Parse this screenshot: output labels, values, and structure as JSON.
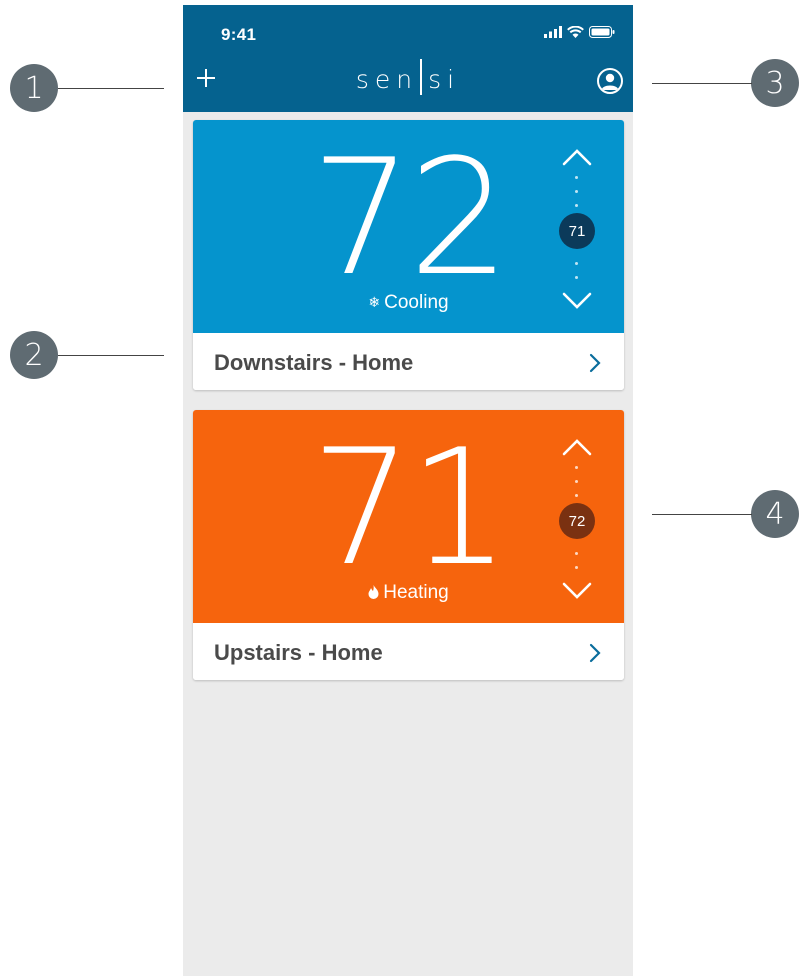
{
  "callouts": [
    "1",
    "2",
    "3",
    "4"
  ],
  "status_bar": {
    "time": "9:41"
  },
  "header": {
    "logo_left": "sen",
    "logo_right": "si"
  },
  "thermostats": [
    {
      "room": "Downstairs - Home",
      "temperature": "72",
      "mode": "Cooling",
      "setpoint": "71",
      "color": "#0594cd",
      "setpoint_color": "#0b3a5a"
    },
    {
      "room": "Upstairs - Home",
      "temperature": "71",
      "mode": "Heating",
      "setpoint": "72",
      "color": "#f6640d",
      "setpoint_color": "#7a3111"
    }
  ],
  "colors": {
    "header": "#05628f",
    "background": "#ebebeb",
    "chevron": "#0a6d9c",
    "callout": "#5f6b72"
  },
  "icons": [
    "plus-icon",
    "profile-icon",
    "signal-icon",
    "wifi-icon",
    "battery-icon",
    "snowflake-icon",
    "flame-icon",
    "chevron-up-icon",
    "chevron-down-icon",
    "chevron-right-icon"
  ]
}
